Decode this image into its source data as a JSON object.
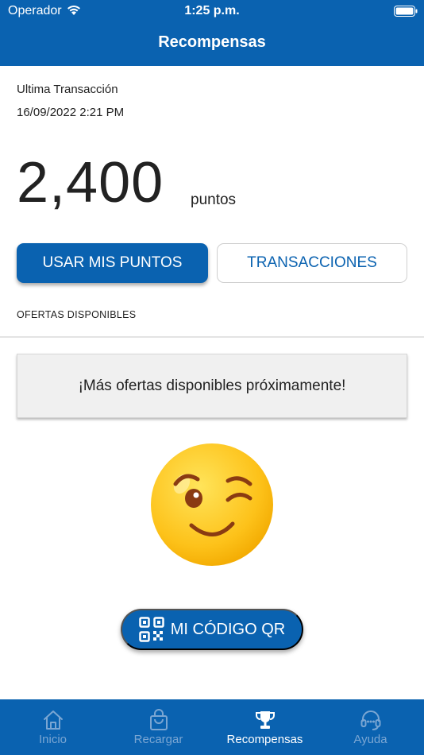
{
  "status_bar": {
    "carrier": "Operador",
    "time": "1:25 p.m."
  },
  "header": {
    "title": "Recompensas"
  },
  "last_transaction": {
    "label": "Ultima Transacción",
    "date": "16/09/2022 2:21 PM"
  },
  "points": {
    "value": "2,400",
    "unit": "puntos"
  },
  "buttons": {
    "use_points": "USAR MIS PUNTOS",
    "transactions": "TRANSACCIONES",
    "qr_code": "MI CÓDIGO QR"
  },
  "offers": {
    "section_label": "OFERTAS DISPONIBLES",
    "empty_message": "¡Más ofertas disponibles próximamente!"
  },
  "tabs": [
    {
      "label": "Inicio",
      "icon": "home-icon",
      "active": false
    },
    {
      "label": "Recargar",
      "icon": "bag-icon",
      "active": false
    },
    {
      "label": "Recompensas",
      "icon": "trophy-icon",
      "active": true
    },
    {
      "label": "Ayuda",
      "icon": "headset-icon",
      "active": false
    }
  ],
  "colors": {
    "brand": "#0a62b0",
    "tab_inactive": "#7aa6d3",
    "card_bg": "#f0f0f0"
  }
}
